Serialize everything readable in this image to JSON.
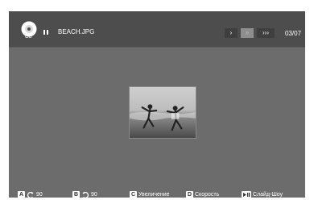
{
  "topbar": {
    "disc_label": "CD",
    "filename": "BEACH.JPG",
    "speed": [
      "›",
      "»",
      "›››"
    ],
    "counter": "03/07"
  },
  "photo": {
    "description_icon": "beach-photo"
  },
  "bottombar": {
    "a_key": "A",
    "a_value": "90",
    "b_key": "B",
    "b_value": "90",
    "c_key": "C",
    "c_label": "Увеличение",
    "d_key": "D",
    "d_label": "Скорость",
    "e_label": "Слайд-Шоу"
  },
  "colors": {
    "screen": "#6c6c6c",
    "topbar": "#4d4d4d"
  }
}
